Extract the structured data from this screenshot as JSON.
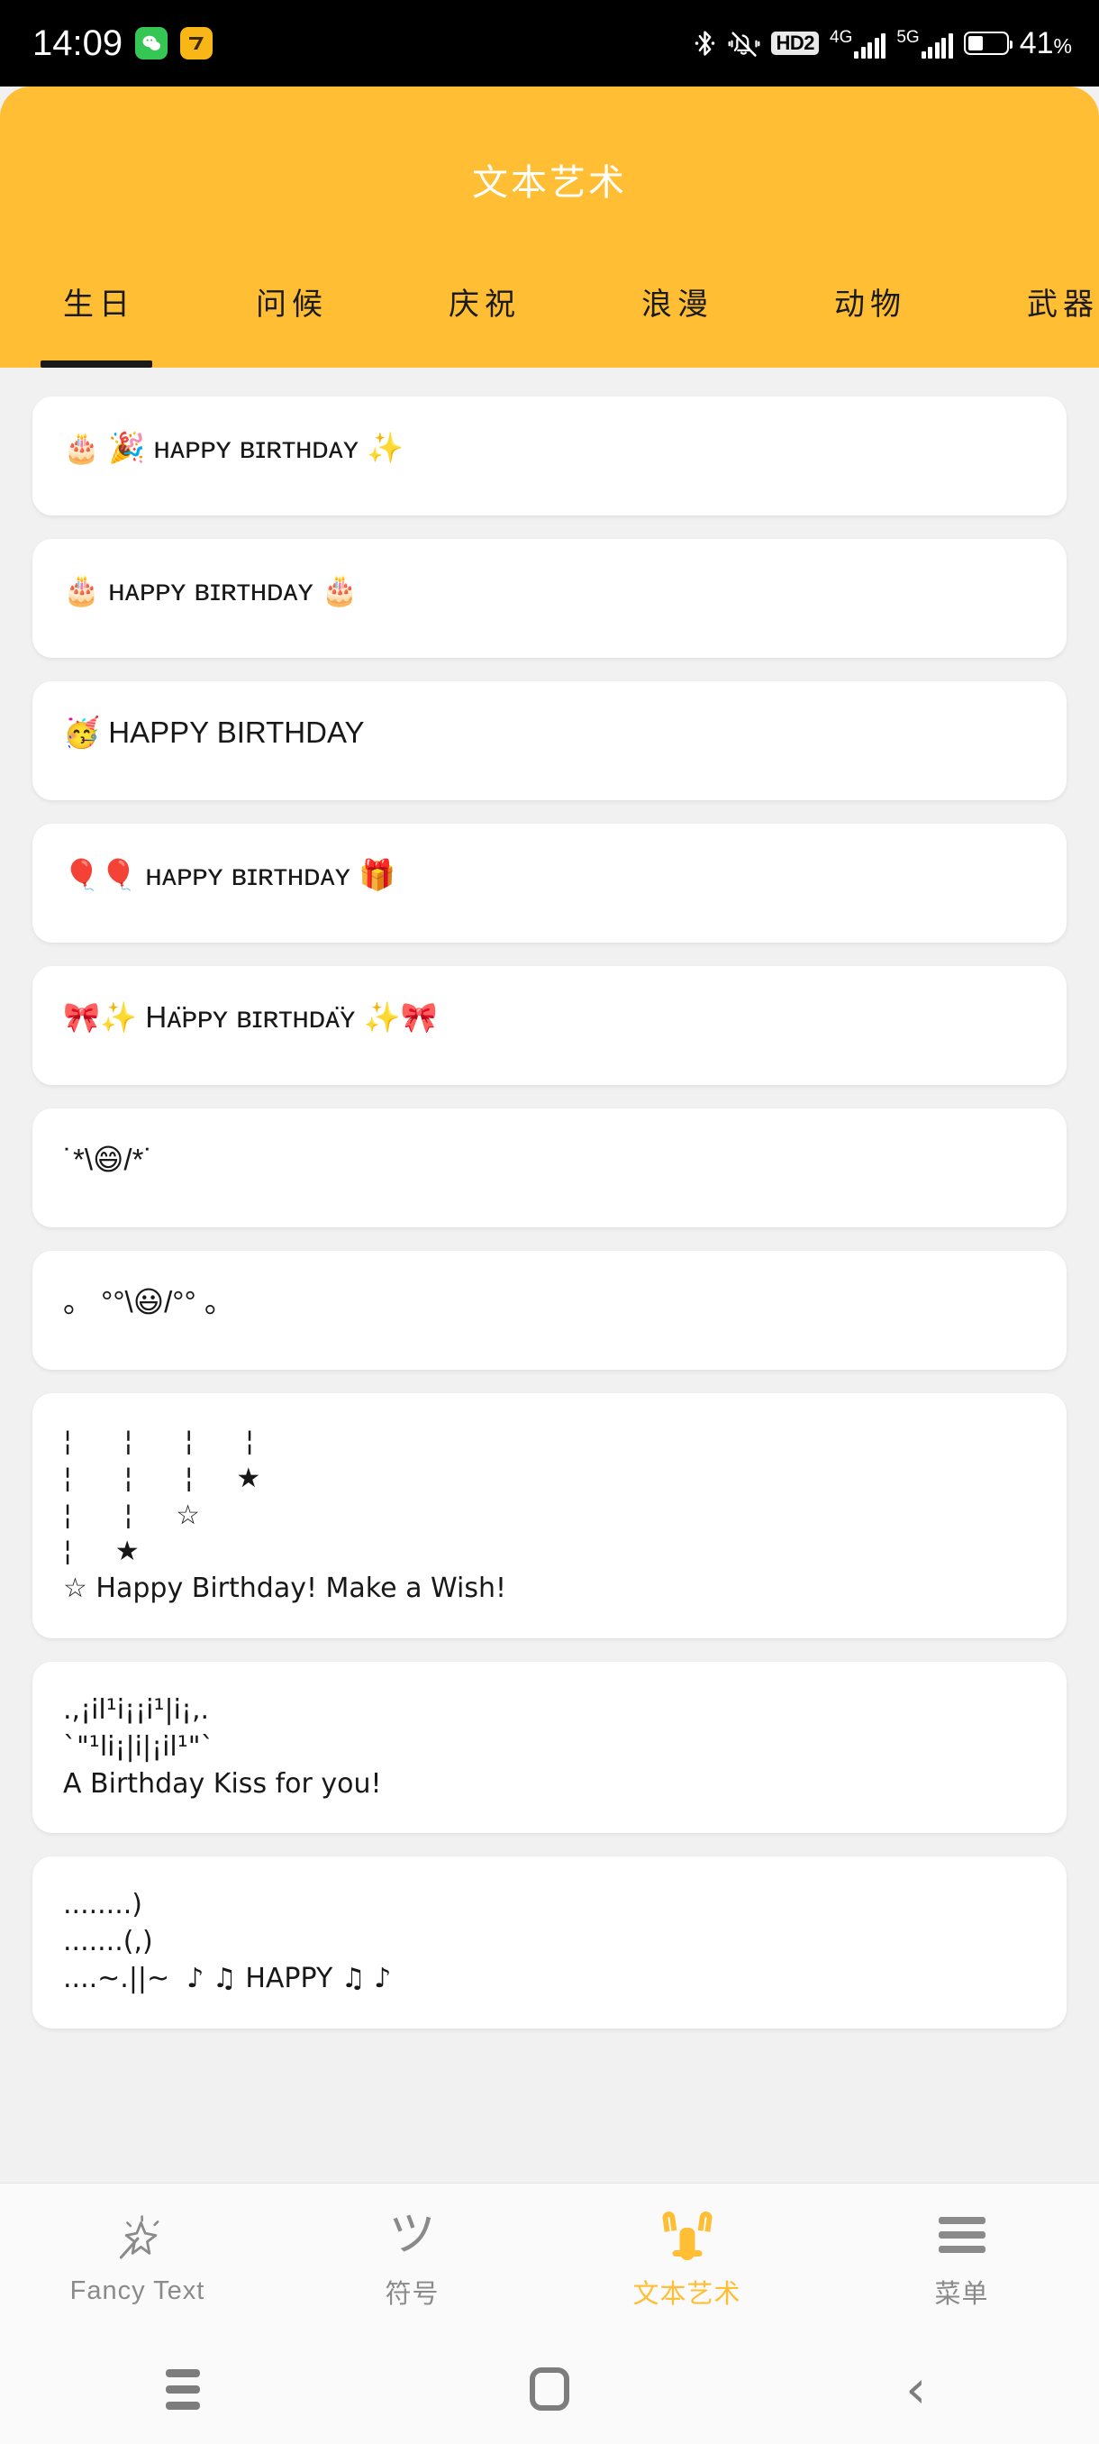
{
  "statusbar": {
    "clock": "14:09",
    "app_icons": [
      "wechat-icon",
      "qq-reader-icon"
    ],
    "hd_label": "HD2",
    "sim1_label": "4G",
    "sim2_label": "5G",
    "battery_percent": "41",
    "battery_percent_unit": "%",
    "battery_level": 41,
    "icons": [
      "bluetooth-icon",
      "vibrate-mute-icon",
      "hd2-badge",
      "signal-4g",
      "signal-5g",
      "battery-icon"
    ]
  },
  "header": {
    "title": "文本艺术",
    "background_color": "#FFBE33",
    "title_color": "#FFFFFF",
    "tabs": [
      {
        "label": "生日",
        "active": true
      },
      {
        "label": "问候",
        "active": false
      },
      {
        "label": "庆祝",
        "active": false
      },
      {
        "label": "浪漫",
        "active": false
      },
      {
        "label": "动物",
        "active": false
      },
      {
        "label": "武器",
        "active": false
      }
    ],
    "active_indicator_color": "#1A1A1A"
  },
  "list": {
    "items": [
      {
        "id": "item-1",
        "text": "🎂 🎉 ʜᴀᴘᴘʏ ʙɪʀᴛʜᴅᴀʏ ✨",
        "lines": 1
      },
      {
        "id": "item-2",
        "text": "🎂 ʜᴀᴘᴘʏ ʙɪʀᴛʜᴅᴀʏ 🎂",
        "lines": 1
      },
      {
        "id": "item-3",
        "text": "🥳 HAPPY BIRTHDAY",
        "lines": 1
      },
      {
        "id": "item-4",
        "text": "🎈🎈 ʜᴀᴘᴘʏ ʙɪʀᴛʜᴅᴀʏ 🎁",
        "lines": 1
      },
      {
        "id": "item-5",
        "text": "🎀✨ Hᴀ̈ᴘᴘʏ ʙɪʀᴛʜᴅᴀ̈ʏ ✨🎀",
        "lines": 1
      },
      {
        "id": "item-6",
        "text": "˙*\\😄/*˙",
        "lines": 1
      },
      {
        "id": "item-7",
        "text": "。 °°\\😃/°° 。",
        "lines": 1
      },
      {
        "id": "item-8",
        "text": "¦      ¦      ¦      ¦\n¦      ¦      ¦     ★\n¦      ¦     ☆\n¦     ★\n☆ Happy Birthday! Make a Wish!",
        "lines": 5
      },
      {
        "id": "item-9",
        "text": ".,¡il¹i¡¡i¹|i¡,.\n`\"¹li¡|i|¡il¹\"`\nA Birthday Kiss for you!",
        "lines": 3
      },
      {
        "id": "item-10",
        "text": "........)\n.......(,)\n....~.||~  ♪ ♫ HAPPY ♫ ♪",
        "lines": 3
      }
    ]
  },
  "bottomnav": {
    "items": [
      {
        "label": "Fancy Text",
        "icon": "magic-wand-icon",
        "active": false
      },
      {
        "label": "符号",
        "icon": "tsu-glyph-icon",
        "active": false
      },
      {
        "label": "文本艺术",
        "icon": "cat-text-art-icon",
        "active": true
      },
      {
        "label": "菜单",
        "icon": "hamburger-menu-icon",
        "active": false
      }
    ],
    "active_color": "#FFBE33",
    "inactive_color": "#8A8A8A"
  },
  "androidnav": {
    "items": [
      {
        "name": "recents-button",
        "icon": "recents-icon"
      },
      {
        "name": "home-button",
        "icon": "home-icon"
      },
      {
        "name": "back-button",
        "icon": "back-chevron-icon"
      }
    ]
  },
  "colors": {
    "page_background": "#F1F1F1",
    "card_background": "#FFFFFF",
    "accent": "#FFBE33",
    "text": "#181818"
  }
}
